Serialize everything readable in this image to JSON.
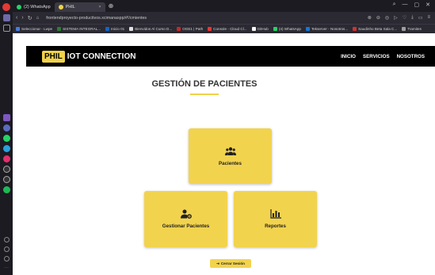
{
  "browser": {
    "tabs": [
      {
        "label": "(2) WhatsApp",
        "active": false,
        "color": "#25d366"
      },
      {
        "label": "PHIL",
        "active": true,
        "color": "#f0d24a"
      }
    ],
    "url": "frontendproyecto-productivos.xcimanaspp/#!/cmientes",
    "bookmarks": [
      {
        "label": "Seleccionar - Lwpe",
        "color": "#4a7bd8"
      },
      {
        "label": "SISTEMA INTEGRAL...",
        "color": "#2e7d32"
      },
      {
        "label": "Inicio 01",
        "color": "#1565c0"
      },
      {
        "label": "Bienvidos Al Curso D...",
        "color": "#e0e0e0"
      },
      {
        "label": "OGE1 | Path",
        "color": "#c62828"
      },
      {
        "label": "Console - Cloud Cl...",
        "color": "#e53935"
      },
      {
        "label": "GitHub",
        "color": "#f5f5f5"
      },
      {
        "label": "(4) WhatsApp",
        "color": "#25d366"
      },
      {
        "label": "Tekserver - Nosotros...",
        "color": "#1976d2"
      },
      {
        "label": "Saudinho Beta Sala C...",
        "color": "#d32f2f"
      },
      {
        "label": "Tramites",
        "color": "#9e9e9e"
      }
    ]
  },
  "navbar": {
    "brand_badge": "PHIL",
    "brand_text": "IOT CONNECTION",
    "links": [
      "INICIO",
      "SERVICIOS",
      "NOSOTROS"
    ]
  },
  "main": {
    "title": "GESTIÓN DE PACIENTES",
    "cards": [
      {
        "label": "Pacientes",
        "icon": "users-icon"
      },
      {
        "label": "Gestionar Pacientes",
        "icon": "user-gear-icon"
      },
      {
        "label": "Reportes",
        "icon": "chart-icon"
      }
    ],
    "logout_label": "Cerrar Sesión"
  },
  "colors": {
    "accent": "#f2d34e",
    "navbar_bg": "#000000",
    "sidebar_bg": "#1c1b22"
  }
}
